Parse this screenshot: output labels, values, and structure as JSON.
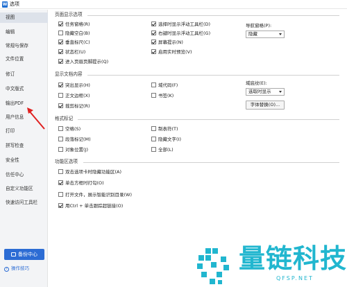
{
  "window": {
    "title": "选项",
    "app_icon_letter": "W"
  },
  "sidebar": {
    "items": [
      {
        "label": "视图",
        "active": true
      },
      {
        "label": "编辑"
      },
      {
        "label": "常规与保存"
      },
      {
        "label": "文件位置"
      },
      {
        "label": "修订"
      },
      {
        "label": "中文版式"
      },
      {
        "label": "输出PDF"
      },
      {
        "label": "用户信息"
      },
      {
        "label": "打印"
      },
      {
        "label": "拼写检查"
      },
      {
        "label": "安全性"
      },
      {
        "label": "信任中心"
      },
      {
        "label": "自定义功能区"
      },
      {
        "label": "快速访问工具栏"
      }
    ],
    "backup_label": "备份中心",
    "tips_label": "操作技巧"
  },
  "page_display": {
    "title": "页面显示选项",
    "col1": [
      {
        "label": "任务窗格(R)",
        "checked": true
      },
      {
        "label": "隐藏空白(B)",
        "checked": false
      },
      {
        "label": "垂直标尺(C)",
        "checked": true
      },
      {
        "label": "状态栏(U)",
        "checked": true
      },
      {
        "label": "进入页眉页脚提示(Q)",
        "checked": true
      }
    ],
    "col2": [
      {
        "label": "选择时显示浮动工具栏(D)",
        "checked": true
      },
      {
        "label": "右键时显示浮动工具栏(G)",
        "checked": true
      },
      {
        "label": "屏幕提示(N)",
        "checked": true
      },
      {
        "label": "启用实时预览(V)",
        "checked": true
      }
    ],
    "nav_label": "导航窗格(P):",
    "nav_value": "隐藏"
  },
  "doc_content": {
    "title": "显示文档内容",
    "col1": [
      {
        "label": "突出显示(H)",
        "checked": true
      },
      {
        "label": "正文边框(X)",
        "checked": false
      },
      {
        "label": "裁剪标记(R)",
        "checked": true
      }
    ],
    "col2": [
      {
        "label": "域代码(F)",
        "checked": false
      },
      {
        "label": "书签(K)",
        "checked": false
      }
    ],
    "shading_label": "域底纹(E):",
    "shading_value": "选取时显示",
    "font_button": "字体替换(O)..."
  },
  "format_marks": {
    "title": "格式标记",
    "col1": [
      {
        "label": "空格(S)",
        "checked": false
      },
      {
        "label": "段落标记(M)",
        "checked": false
      },
      {
        "label": "对象位置(J)",
        "checked": false
      }
    ],
    "col2": [
      {
        "label": "制表符(T)",
        "checked": false
      },
      {
        "label": "隐藏文字(I)",
        "checked": false
      },
      {
        "label": "全部(L)",
        "checked": false
      }
    ]
  },
  "ribbon": {
    "title": "功能区选项",
    "items": [
      {
        "label": "双击选项卡时隐藏功能区(A)",
        "checked": false
      },
      {
        "label": "单击方框时打勾(O)",
        "checked": true
      },
      {
        "label": "打开文件，展示智能识别目录(W)",
        "checked": false
      },
      {
        "label": "用Ctrl + 单击跟踪超链接(O)",
        "checked": true
      }
    ]
  },
  "watermark": {
    "text": "量链科技",
    "sub": "QFSP.NET"
  },
  "colors": {
    "accent": "#2c6cd4",
    "watermark": "#21b6cf",
    "arrow": "#e02020"
  }
}
